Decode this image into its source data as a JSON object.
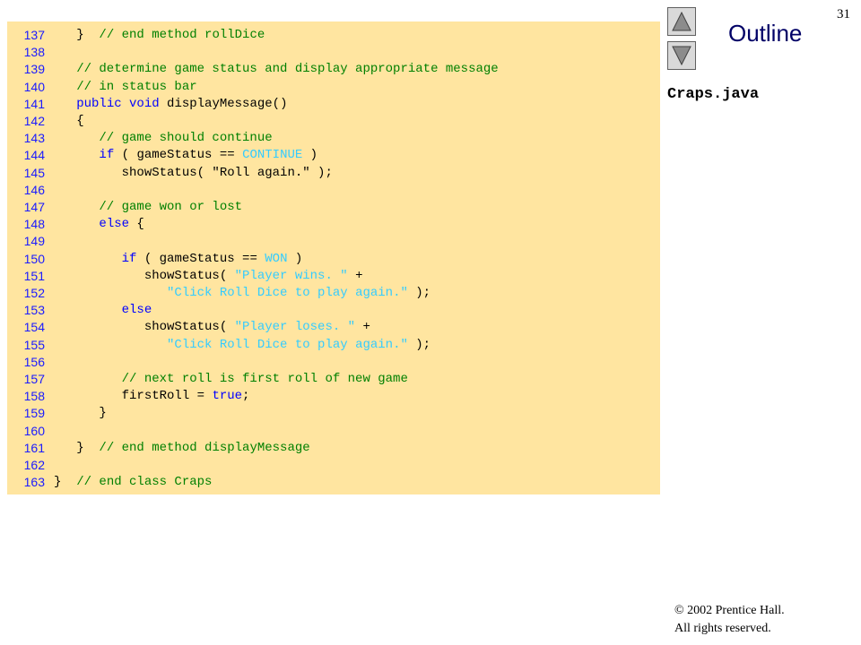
{
  "slide": {
    "number": "31",
    "outline_title": "Outline",
    "file_name": "Craps.java",
    "copyright_line1": "© 2002 Prentice Hall.",
    "copyright_line2": "All rights reserved.",
    "nav_up_icon": "up-triangle-icon",
    "nav_down_icon": "down-triangle-icon"
  },
  "colors": {
    "code_background": "#ffe5a0",
    "line_number": "#1a1aff",
    "comment": "#008000",
    "keyword": "#0000ff",
    "constant": "#33ccff",
    "outline_title": "#000066"
  },
  "code": {
    "lines": [
      {
        "num": "137",
        "tokens": [
          {
            "t": "   }  ",
            "c": "plain"
          },
          {
            "t": "// end method rollDice",
            "c": "comment"
          }
        ]
      },
      {
        "num": "138",
        "tokens": []
      },
      {
        "num": "139",
        "tokens": [
          {
            "t": "   // determine game status and display appropriate message",
            "c": "comment"
          }
        ]
      },
      {
        "num": "140",
        "tokens": [
          {
            "t": "   // in status bar",
            "c": "comment"
          }
        ]
      },
      {
        "num": "141",
        "tokens": [
          {
            "t": "   ",
            "c": "plain"
          },
          {
            "t": "public void ",
            "c": "keyword"
          },
          {
            "t": "displayMessage()",
            "c": "plain"
          }
        ]
      },
      {
        "num": "142",
        "tokens": [
          {
            "t": "   {",
            "c": "plain"
          }
        ]
      },
      {
        "num": "143",
        "tokens": [
          {
            "t": "      // game should continue",
            "c": "comment"
          }
        ]
      },
      {
        "num": "144",
        "tokens": [
          {
            "t": "      ",
            "c": "plain"
          },
          {
            "t": "if",
            "c": "keyword"
          },
          {
            "t": " ( gameStatus == ",
            "c": "plain"
          },
          {
            "t": "CONTINUE",
            "c": "constant"
          },
          {
            "t": " )",
            "c": "plain"
          }
        ]
      },
      {
        "num": "145",
        "tokens": [
          {
            "t": "         showStatus( \"Roll again.\" );",
            "c": "plain"
          }
        ]
      },
      {
        "num": "146",
        "tokens": []
      },
      {
        "num": "147",
        "tokens": [
          {
            "t": "      // game won or lost",
            "c": "comment"
          }
        ]
      },
      {
        "num": "148",
        "tokens": [
          {
            "t": "      ",
            "c": "plain"
          },
          {
            "t": "else",
            "c": "keyword"
          },
          {
            "t": " {",
            "c": "plain"
          }
        ]
      },
      {
        "num": "149",
        "tokens": []
      },
      {
        "num": "150",
        "tokens": [
          {
            "t": "         ",
            "c": "plain"
          },
          {
            "t": "if",
            "c": "keyword"
          },
          {
            "t": " ( gameStatus == ",
            "c": "plain"
          },
          {
            "t": "WON",
            "c": "constant"
          },
          {
            "t": " )",
            "c": "plain"
          }
        ]
      },
      {
        "num": "151",
        "tokens": [
          {
            "t": "            showStatus( ",
            "c": "plain"
          },
          {
            "t": "\"Player wins. \"",
            "c": "string"
          },
          {
            "t": " +",
            "c": "plain"
          }
        ]
      },
      {
        "num": "152",
        "tokens": [
          {
            "t": "               ",
            "c": "plain"
          },
          {
            "t": "\"Click Roll Dice to play again.\"",
            "c": "string"
          },
          {
            "t": " );",
            "c": "plain"
          }
        ]
      },
      {
        "num": "153",
        "tokens": [
          {
            "t": "         ",
            "c": "plain"
          },
          {
            "t": "else",
            "c": "keyword"
          }
        ]
      },
      {
        "num": "154",
        "tokens": [
          {
            "t": "            showStatus( ",
            "c": "plain"
          },
          {
            "t": "\"Player loses. \"",
            "c": "string"
          },
          {
            "t": " +",
            "c": "plain"
          }
        ]
      },
      {
        "num": "155",
        "tokens": [
          {
            "t": "               ",
            "c": "plain"
          },
          {
            "t": "\"Click Roll Dice to play again.\"",
            "c": "string"
          },
          {
            "t": " );",
            "c": "plain"
          }
        ]
      },
      {
        "num": "156",
        "tokens": []
      },
      {
        "num": "157",
        "tokens": [
          {
            "t": "         // next roll is first roll of new game",
            "c": "comment"
          }
        ]
      },
      {
        "num": "158",
        "tokens": [
          {
            "t": "         firstRoll = ",
            "c": "plain"
          },
          {
            "t": "true",
            "c": "keyword"
          },
          {
            "t": ";",
            "c": "plain"
          }
        ]
      },
      {
        "num": "159",
        "tokens": [
          {
            "t": "      }",
            "c": "plain"
          }
        ]
      },
      {
        "num": "160",
        "tokens": []
      },
      {
        "num": "161",
        "tokens": [
          {
            "t": "   }  ",
            "c": "plain"
          },
          {
            "t": "// end method displayMessage",
            "c": "comment"
          }
        ]
      },
      {
        "num": "162",
        "tokens": []
      },
      {
        "num": "163",
        "tokens": [
          {
            "t": "}  ",
            "c": "plain"
          },
          {
            "t": "// end class Craps",
            "c": "comment"
          }
        ]
      }
    ]
  }
}
